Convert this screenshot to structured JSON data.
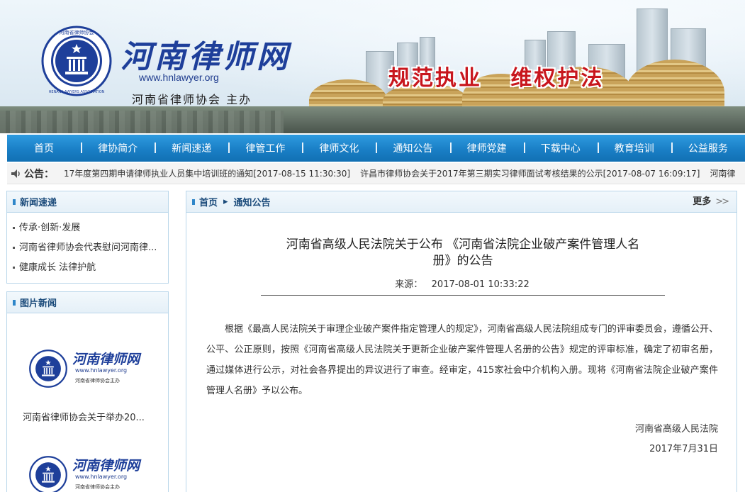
{
  "header": {
    "site_title": "河南律师网",
    "site_url": "www.hnlawyer.org",
    "host": "河南省律师协会 主办",
    "slogan": "规范执业   维权护法",
    "logo_ring_text": "HENAN LAWYERS ASSOCIATION",
    "logo_top_text": "河南省律师协会"
  },
  "nav": {
    "items": [
      "首页",
      "律协简介",
      "新闻速递",
      "律管工作",
      "律师文化",
      "通知公告",
      "律师党建",
      "下载中心",
      "教育培训",
      "公益服务"
    ]
  },
  "notice": {
    "label": "公告：",
    "items": [
      "17年度第四期申请律师执业人员集中培训班的通知[2017-08-15 11:30:30]",
      "许昌市律师协会关于2017年第三期实习律师面试考核结果的公示[2017-08-07 16:09:17]",
      "河南律"
    ]
  },
  "sidebar": {
    "news": {
      "title": "新闻速递",
      "items": [
        "传承·创新·发展",
        "河南省律师协会代表慰问河南律...",
        "健康成长   法律护航"
      ]
    },
    "pictures": {
      "title": "图片新闻",
      "card_title": "河南律师网",
      "card_url": "www.hnlawyer.org",
      "card_host": "河南省律师协会主办",
      "captions": [
        "河南省律师协会关于举办20..."
      ]
    }
  },
  "main": {
    "breadcrumb": [
      "首页",
      "通知公告"
    ],
    "more_label": "更多",
    "article": {
      "title": "河南省高级人民法院关于公布 《河南省法院企业破产案件管理人名册》的公告",
      "meta": "来源：   2017-08-01 10:33:22",
      "body": "根据《最高人民法院关于审理企业破产案件指定管理人的规定》，河南省高级人民法院组成专门的评审委员会，遵循公开、公平、公正原则，按照《河南省高级人民法院关于更新企业破产案件管理人名册的公告》规定的评审标准，确定了初审名册，通过媒体进行公示，对社会各界提出的异议进行了审查。经审定，415家社会中介机构入册。现将《河南省法院企业破产案件管理人名册》予以公布。",
      "signer": "河南省高级人民法院",
      "date": "2017年7月31日"
    }
  },
  "colors": {
    "nav_blue": "#1a7fc6",
    "title_blue": "#1e3f9a",
    "slogan_red": "#c8161d",
    "border_blue": "#b9d6ea"
  }
}
